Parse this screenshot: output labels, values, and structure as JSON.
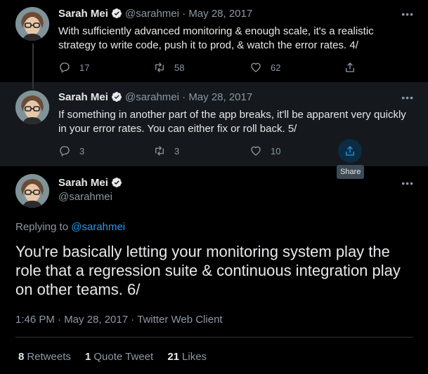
{
  "tweets": [
    {
      "name": "Sarah Mei",
      "handle": "@sarahmei",
      "sep": "·",
      "date": "May 28, 2017",
      "text": "With sufficiently advanced monitoring & enough scale, it's a realistic strategy to write code, push it to prod, & watch the error rates. 4/",
      "replies": "17",
      "retweets": "58",
      "likes": "62"
    },
    {
      "name": "Sarah Mei",
      "handle": "@sarahmei",
      "sep": "·",
      "date": "May 28, 2017",
      "text": "If something in another part of the app breaks, it'll be apparent very quickly in your error rates. You can either fix or roll back. 5/",
      "replies": "3",
      "retweets": "3",
      "likes": "10",
      "tooltip": "Share"
    }
  ],
  "main": {
    "name": "Sarah Mei",
    "handle": "@sarahmei",
    "replying_prefix": "Replying to ",
    "replying_to": "@sarahmei",
    "text": "You're basically letting your monitoring system play the role that a regression suite & continuous integration play on other teams. 6/",
    "meta": "1:46 PM · May 28, 2017 · Twitter Web Client",
    "stats": {
      "retweets_count": "8",
      "retweets_label": "Retweets",
      "quotes_count": "1",
      "quotes_label": "Quote Tweet",
      "likes_count": "21",
      "likes_label": "Likes"
    }
  },
  "more_label": "•••",
  "colors": {
    "accent": "#1d9bf0",
    "secondary_text": "#8b98a5",
    "highlight_bg": "#15181c"
  },
  "icons": [
    "verified-badge-icon",
    "reply-icon",
    "retweet-icon",
    "like-icon",
    "share-icon",
    "more-icon"
  ]
}
